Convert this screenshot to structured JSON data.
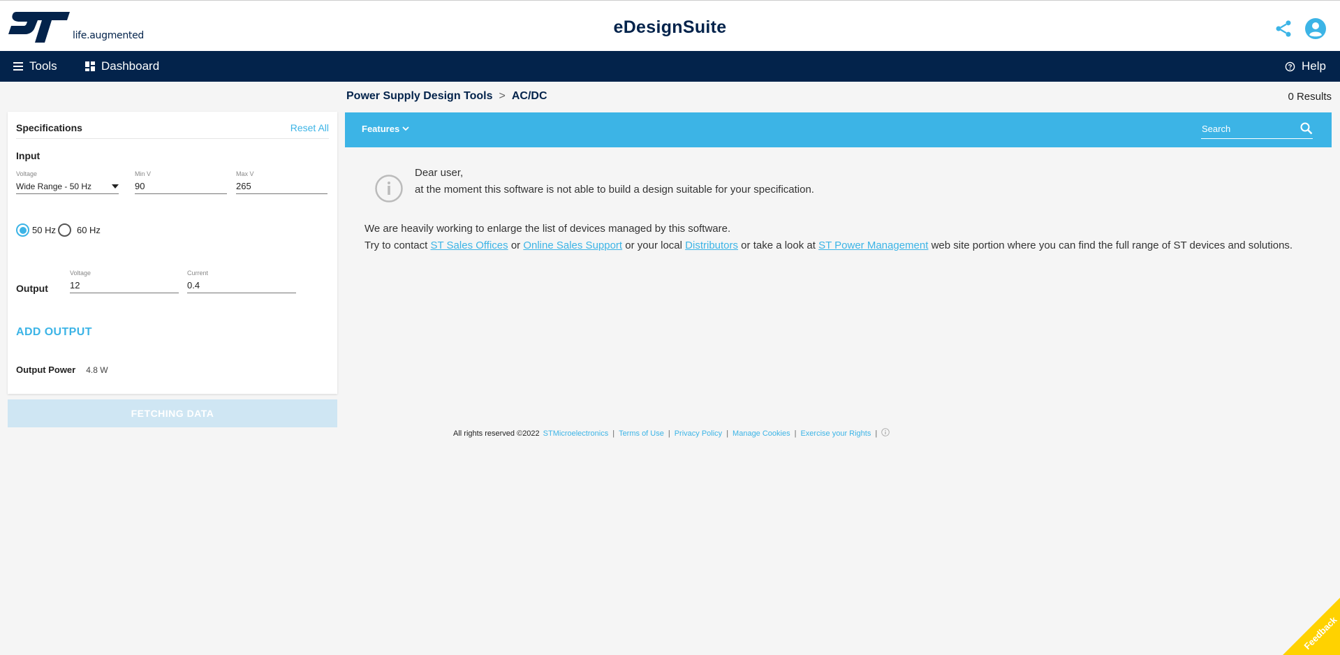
{
  "header": {
    "logo_text": "ST",
    "tagline": "life.augmented",
    "title": "eDesignSuite",
    "icons": [
      "share-icon",
      "user-account-icon"
    ]
  },
  "nav": {
    "tools": "Tools",
    "dashboard": "Dashboard",
    "help": "Help"
  },
  "breadcrumb": {
    "parent": "Power Supply Design Tools",
    "separator": ">",
    "current": "AC/DC"
  },
  "results_count": "0 Results",
  "specs": {
    "title": "Specifications",
    "reset": "Reset All",
    "input_label": "Input",
    "voltage_label": "Voltage",
    "voltage_value": "Wide Range - 50 Hz",
    "min_label": "Min V",
    "min_value": "90",
    "max_label": "Max V",
    "max_value": "265",
    "freq_options": [
      {
        "label": "50 Hz",
        "selected": true
      },
      {
        "label": "60 Hz",
        "selected": false
      }
    ],
    "output_label": "Output",
    "out_voltage_label": "Voltage",
    "out_voltage_value": "12",
    "out_current_label": "Current",
    "out_current_value": "0.4",
    "add_output": "ADD OUTPUT",
    "power_label": "Output Power",
    "power_value": "4.8 W"
  },
  "fetch_button": "FETCHING DATA",
  "features": {
    "label": "Features",
    "search_placeholder": "Search"
  },
  "message": {
    "greeting": "Dear user,",
    "line1": "at the moment this software is not able to build a design suitable for your specification.",
    "para1": "We are heavily working to enlarge the list of devices managed by this software.",
    "p2_a": "Try to contact ",
    "link_sales": "ST Sales Offices",
    "p2_b": " or ",
    "link_online": "Online Sales Support",
    "p2_c": " or your local ",
    "link_dist": "Distributors",
    "p2_d": " or take a look at ",
    "link_power": "ST Power Management",
    "p2_e": " web site portion where you can find the full range of ST devices and solutions."
  },
  "footer": {
    "rights": "All rights reserved ©2022",
    "company": "STMicroelectronics",
    "terms": "Terms of Use",
    "privacy": "Privacy Policy",
    "cookies": "Manage Cookies",
    "rights_link": "Exercise your Rights"
  },
  "feedback": "Feedback",
  "colors": {
    "navy": "#03234b",
    "accent": "#3cb4e6",
    "feedback": "#ffd200"
  }
}
